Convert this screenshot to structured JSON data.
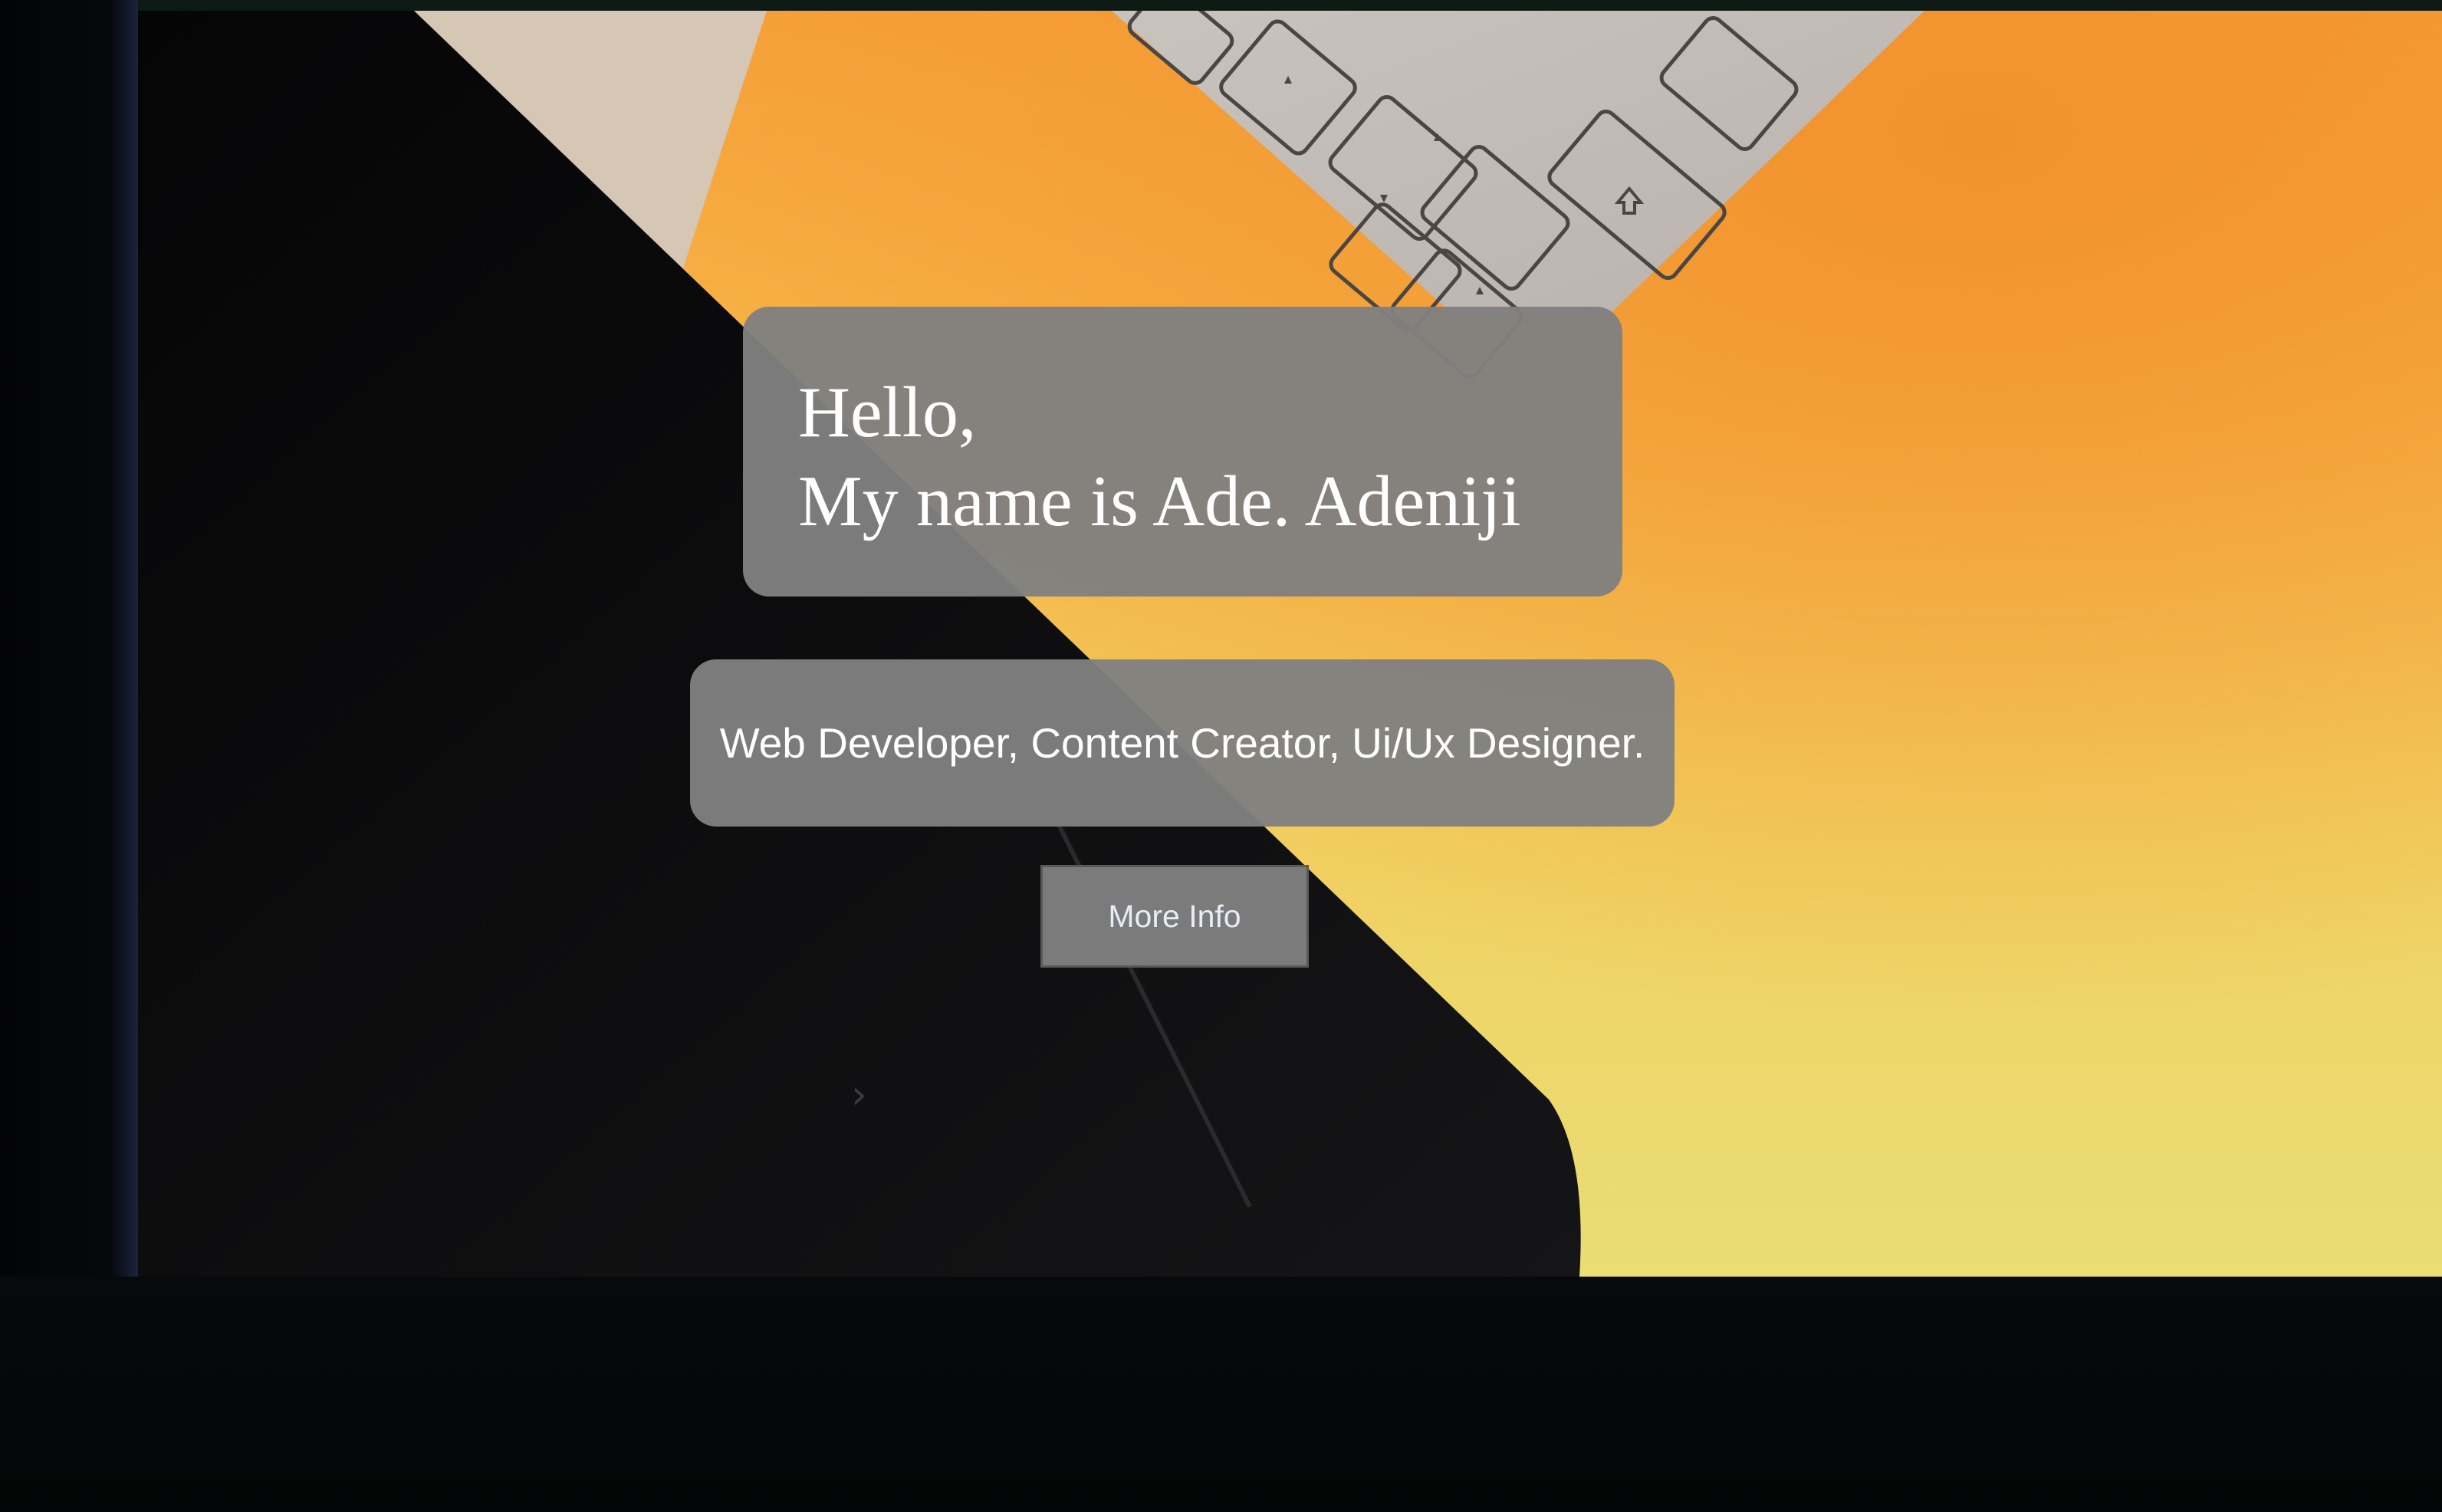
{
  "hero": {
    "greeting": "Hello,",
    "name_line": "My name is Ade. Adeniji"
  },
  "tagline": {
    "text": "Web Developer, Content Creator, Ui/Ux Designer."
  },
  "cta": {
    "label": "More Info"
  },
  "icons": {
    "carousel_next": "chevron-right-icon",
    "carousel_next_glyph": "›",
    "key_arrow": "arrow-key-icon",
    "key_shift": "shift-key-icon"
  },
  "colors": {
    "background_orange": "#f6a13a",
    "background_yellow": "#e9dd74",
    "card_gray": "#808080",
    "button_gray": "#7b7b7b",
    "text_white": "#ffffff",
    "dark_laptop": "#0b0b0c"
  }
}
